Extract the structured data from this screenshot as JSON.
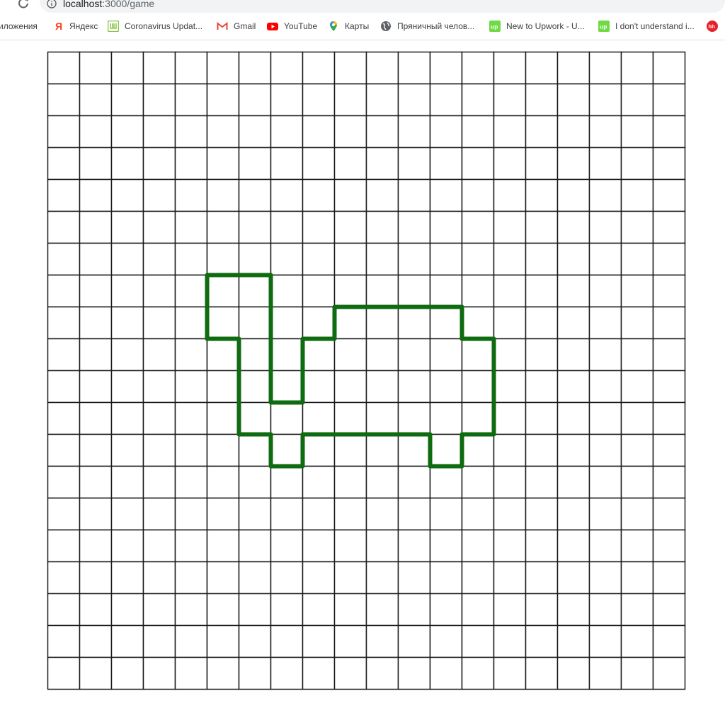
{
  "browser": {
    "url_host": "localhost",
    "url_path": ":3000/game",
    "bookmarks": [
      {
        "label": "иложения",
        "icon": "apps-icon"
      },
      {
        "label": "Яндекс",
        "icon": "yandex-icon"
      },
      {
        "label": "Coronavirus Updat...",
        "icon": "worldometer-icon"
      },
      {
        "label": "Gmail",
        "icon": "gmail-icon"
      },
      {
        "label": "YouTube",
        "icon": "youtube-icon"
      },
      {
        "label": "Карты",
        "icon": "maps-icon"
      },
      {
        "label": "Пряничный челов...",
        "icon": "globe-icon"
      },
      {
        "label": "New to Upwork - U...",
        "icon": "upwork-icon"
      },
      {
        "label": "I don't understand i...",
        "icon": "upwork-icon"
      },
      {
        "label": "",
        "icon": "hh-icon"
      }
    ]
  },
  "game": {
    "grid_cols": 20,
    "grid_rows": 20,
    "grid_color": "#1a1a1a",
    "shape_color": "#0f6b0f",
    "shape_outline_cells": [
      [
        5,
        7
      ],
      [
        7,
        7
      ],
      [
        7,
        11
      ],
      [
        8,
        11
      ],
      [
        8,
        9
      ],
      [
        9,
        9
      ],
      [
        9,
        8
      ],
      [
        13,
        8
      ],
      [
        13,
        9
      ],
      [
        14,
        9
      ],
      [
        14,
        12
      ],
      [
        13,
        12
      ],
      [
        13,
        13
      ],
      [
        12,
        13
      ],
      [
        12,
        12
      ],
      [
        8,
        12
      ],
      [
        8,
        13
      ],
      [
        7,
        13
      ],
      [
        7,
        12
      ],
      [
        6,
        12
      ],
      [
        6,
        9
      ],
      [
        5,
        9
      ]
    ]
  },
  "colors": {
    "yandex_red": "#fc3f1d",
    "worldometer_green": "#8bc34a",
    "gmail_red": "#ea4335",
    "youtube_red": "#ff0000",
    "upwork_green": "#6fda44",
    "hh_red": "#e8202a"
  }
}
